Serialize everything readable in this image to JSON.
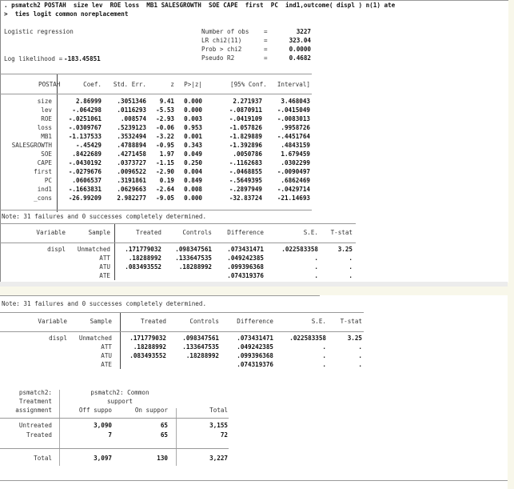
{
  "command": {
    "line1": ". psmatch2 POSTAH  size lev  ROE loss  MB1 SALESGROWTH  SOE CAPE  first  PC  ind1,outcome( displ ) n(1) ate",
    "line2": ">  ties logit common noreplacement"
  },
  "logit": {
    "title": "Logistic regression",
    "loglik_label": "Log likelihood = ",
    "loglik_value": "-183.45851",
    "stats": [
      {
        "label": "Number of obs",
        "eq": "=",
        "value": "3227"
      },
      {
        "label": "LR chi2(11)",
        "eq": "=",
        "value": "323.04"
      },
      {
        "label": "Prob > chi2",
        "eq": "=",
        "value": "0.0000"
      },
      {
        "label": "Pseudo R2",
        "eq": "=",
        "value": "0.4682"
      }
    ],
    "headers": [
      "POSTAH",
      "Coef.",
      "Std. Err.",
      "z",
      "P>|z|",
      "[95% Conf.",
      "Interval]"
    ],
    "rows": [
      [
        "size",
        "2.86999",
        ".3051346",
        "9.41",
        "0.000",
        "2.271937",
        "3.468043"
      ],
      [
        "lev",
        "-.064298",
        ".0116293",
        "-5.53",
        "0.000",
        "-.0870911",
        "-.0415049"
      ],
      [
        "ROE",
        "-.0251061",
        ".008574",
        "-2.93",
        "0.003",
        "-.0419109",
        "-.0083013"
      ],
      [
        "loss",
        "-.0309767",
        ".5239123",
        "-0.06",
        "0.953",
        "-1.057826",
        ".9958726"
      ],
      [
        "MB1",
        "-1.137533",
        ".3532494",
        "-3.22",
        "0.001",
        "-1.829889",
        "-.4451764"
      ],
      [
        "SALESGROWTH",
        "-.45429",
        ".4788894",
        "-0.95",
        "0.343",
        "-1.392896",
        ".4843159"
      ],
      [
        "SOE",
        ".8422689",
        ".4271458",
        "1.97",
        "0.049",
        ".0050786",
        "1.679459"
      ],
      [
        "CAPE",
        "-.0430192",
        ".0373727",
        "-1.15",
        "0.250",
        "-.1162683",
        ".0302299"
      ],
      [
        "first",
        "-.0279676",
        ".0096522",
        "-2.90",
        "0.004",
        "-.0468855",
        "-.0090497"
      ],
      [
        "PC",
        ".0606537",
        ".3191861",
        "0.19",
        "0.849",
        "-.5649395",
        ".6862469"
      ],
      [
        "ind1",
        "-.1663831",
        ".0629663",
        "-2.64",
        "0.008",
        "-.2897949",
        "-.0429714"
      ],
      [
        "_cons",
        "-26.99209",
        "2.982277",
        "-9.05",
        "0.000",
        "-32.83724",
        "-21.14693"
      ]
    ]
  },
  "note": "Note: 31 failures and 0 successes completely determined.",
  "att": {
    "headers": [
      "Variable",
      "Sample",
      "Treated",
      "Controls",
      "Difference",
      "S.E.",
      "T-stat"
    ],
    "rows": [
      [
        "displ",
        "Unmatched",
        ".171779032",
        ".098347561",
        ".073431471",
        ".022583358",
        "3.25"
      ],
      [
        "",
        "ATT",
        ".18288992",
        ".133647535",
        ".049242385",
        ".",
        "."
      ],
      [
        "",
        "ATU",
        ".083493552",
        ".18288992",
        ".099396368",
        ".",
        "."
      ],
      [
        "",
        "ATE",
        "",
        "",
        ".074319376",
        ".",
        "."
      ]
    ]
  },
  "tab": {
    "rowhead": [
      "psmatch2:",
      "Treatment",
      "assignment"
    ],
    "colhead1": "psmatch2: Common",
    "colhead2": "support",
    "cols": [
      "Off suppo",
      "On suppor",
      "Total"
    ],
    "rows": [
      [
        "Untreated",
        "3,090",
        "65",
        "3,155"
      ],
      [
        "Treated",
        "7",
        "65",
        "72"
      ]
    ],
    "total": [
      "Total",
      "3,097",
      "130",
      "3,227"
    ]
  }
}
